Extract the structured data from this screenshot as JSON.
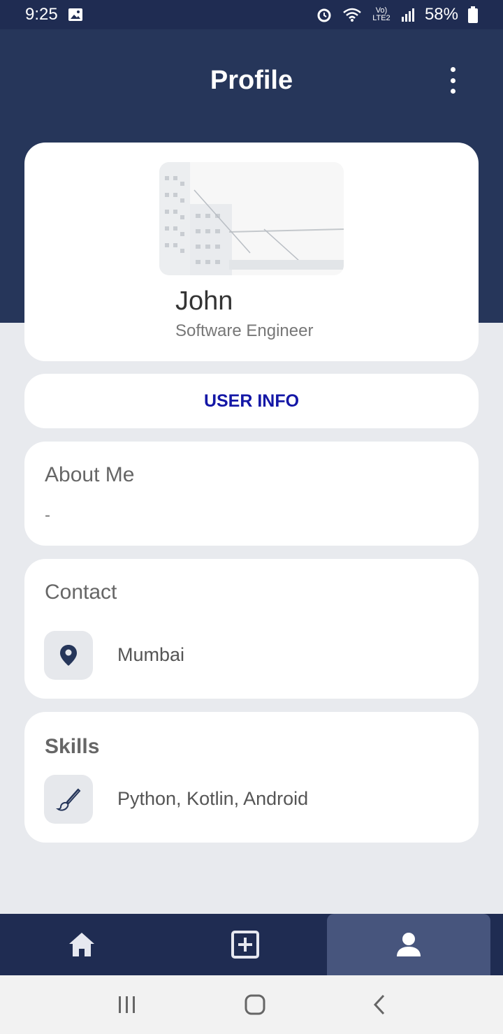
{
  "status_bar": {
    "time": "9:25",
    "battery": "58%",
    "network_label": "Vo) LTE2"
  },
  "header": {
    "title": "Profile"
  },
  "profile": {
    "name": "John",
    "role": "Software Engineer"
  },
  "user_info_button": "USER INFO",
  "about": {
    "title": "About Me",
    "value": "-"
  },
  "contact": {
    "title": "Contact",
    "location": "Mumbai"
  },
  "skills": {
    "title": "Skills",
    "value": "Python, Kotlin, Android"
  },
  "bottom_nav": {
    "items": [
      "home-icon",
      "add-box-icon",
      "person-icon"
    ],
    "active_index": 2
  },
  "colors": {
    "header_bg": "#26365a",
    "status_bg": "#1f2c52",
    "accent_text": "#1417a6",
    "nav_active": "#47557d"
  }
}
